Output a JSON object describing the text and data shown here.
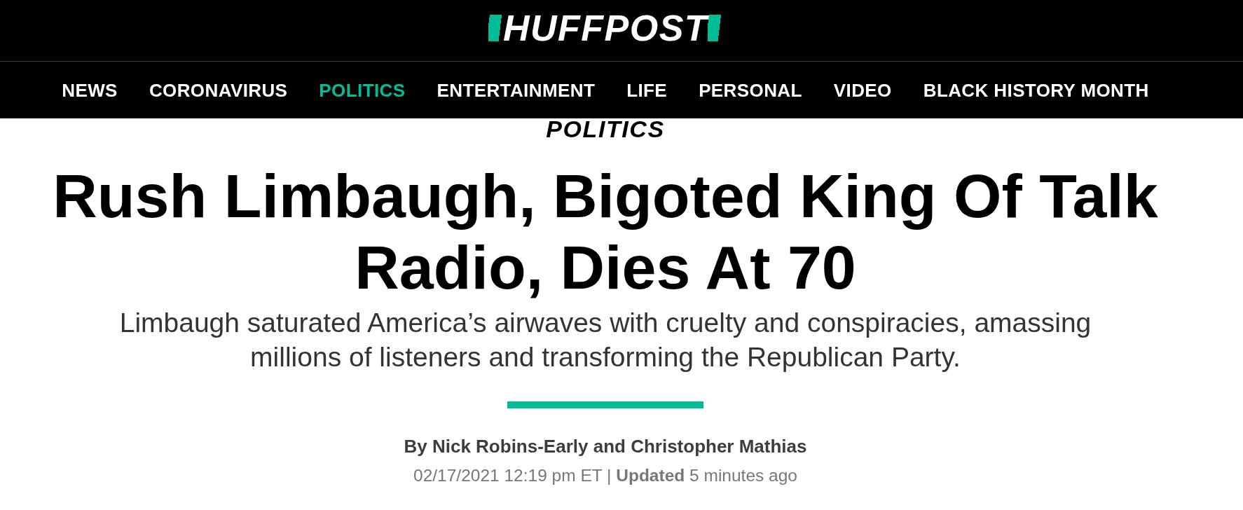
{
  "header": {
    "logo": "HUFFPOST"
  },
  "nav": {
    "items": [
      {
        "label": "NEWS",
        "selected": false
      },
      {
        "label": "CORONAVIRUS",
        "selected": false
      },
      {
        "label": "POLITICS",
        "selected": true
      },
      {
        "label": "ENTERTAINMENT",
        "selected": false
      },
      {
        "label": "LIFE",
        "selected": false
      },
      {
        "label": "PERSONAL",
        "selected": false
      },
      {
        "label": "VIDEO",
        "selected": false
      },
      {
        "label": "BLACK HISTORY MONTH",
        "selected": false
      }
    ]
  },
  "article": {
    "section": "POLITICS",
    "headline": "Rush Limbaugh, Bigoted King Of Talk Radio, Dies At 70",
    "dek": "Limbaugh saturated America’s airwaves with cruelty and conspiracies, amassing millions of listeners and transforming the Republican Party.",
    "byline": "By Nick Robins-Early and Christopher Mathias",
    "timestamp": "02/17/2021 12:19 pm ET | **Updated** 5 minutes ago"
  }
}
